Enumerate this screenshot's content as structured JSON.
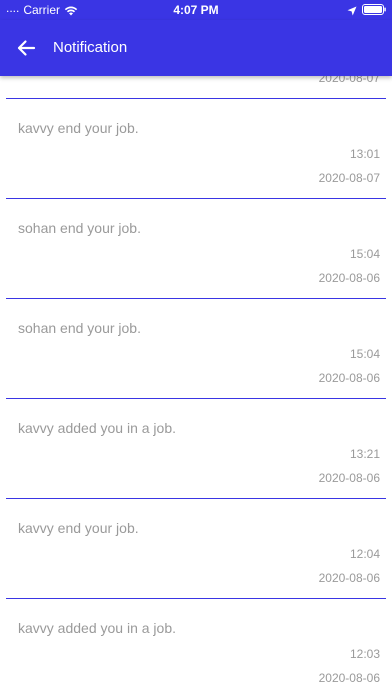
{
  "status_bar": {
    "signal": "....",
    "carrier": "Carrier",
    "time": "4:07 PM"
  },
  "app_bar": {
    "title": "Notification",
    "back_icon": "arrow-left-icon"
  },
  "colors": {
    "primary": "#3a35e4",
    "text_muted": "#9a9a9a",
    "divider": "#3a35e4"
  },
  "notifications": [
    {
      "message": "",
      "time": "",
      "date": "2020-08-07"
    },
    {
      "message": "kavvy end your job.",
      "time": "13:01",
      "date": "2020-08-07"
    },
    {
      "message": "sohan end your job.",
      "time": "15:04",
      "date": "2020-08-06"
    },
    {
      "message": "sohan end your job.",
      "time": "15:04",
      "date": "2020-08-06"
    },
    {
      "message": "kavvy added you in a job.",
      "time": "13:21",
      "date": "2020-08-06"
    },
    {
      "message": "kavvy end your job.",
      "time": "12:04",
      "date": "2020-08-06"
    },
    {
      "message": "kavvy added you in a job.",
      "time": "12:03",
      "date": "2020-08-06"
    }
  ]
}
